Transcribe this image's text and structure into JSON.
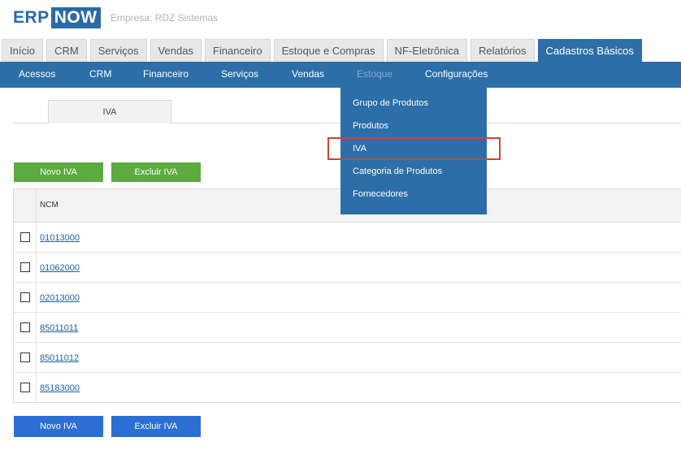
{
  "logo": {
    "part1": "ERP",
    "part2": "NOW"
  },
  "company": "Empresa: RDZ Sistemas",
  "tabs": [
    "Início",
    "CRM",
    "Serviços",
    "Vendas",
    "Financeiro",
    "Estoque e Compras",
    "NF-Eletrônica",
    "Relatórios",
    "Cadastros Básicos"
  ],
  "active_tab": "Cadastros Básicos",
  "subnav": [
    "Acessos",
    "CRM",
    "Financeiro",
    "Serviços",
    "Vendas",
    "Estoque",
    "Configurações"
  ],
  "active_subnav": "Estoque",
  "dropdown": [
    "Grupo de Produtos",
    "Produtos",
    "IVA",
    "Categoria de Produtos",
    "Fornecedores"
  ],
  "highlighted_dropdown_item": "IVA",
  "sub_tab": "IVA",
  "buttons_top": {
    "new": "Novo IVA",
    "delete": "Excluir IVA"
  },
  "buttons_bottom": {
    "new": "Novo IVA",
    "delete": "Excluir IVA"
  },
  "table": {
    "header": "NCM",
    "rows": [
      "01013000",
      "01062000",
      "02013000",
      "85011011",
      "85011012",
      "85183000"
    ]
  },
  "colors": {
    "brand_blue": "#2b6ea8",
    "button_green": "#5bab3e",
    "button_blue": "#2c6fd4",
    "highlight_border": "#c9462c",
    "link": "#1f5fa8"
  }
}
